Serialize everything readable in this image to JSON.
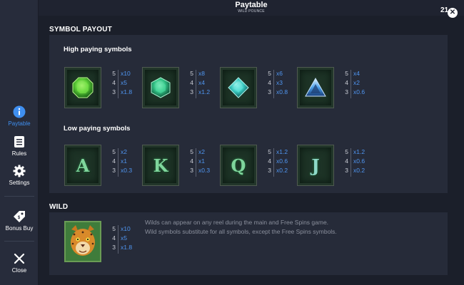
{
  "header": {
    "title": "Paytable",
    "subtitle": "WILD POUNCE",
    "counter": "21"
  },
  "sidebar": {
    "items": [
      {
        "label": "Paytable",
        "icon": "info-icon"
      },
      {
        "label": "Rules",
        "icon": "document-icon"
      },
      {
        "label": "Settings",
        "icon": "gear-icon"
      },
      {
        "label": "Bonus Buy",
        "icon": "price-tag-icon"
      },
      {
        "label": "Close",
        "icon": "close-icon"
      }
    ]
  },
  "colors": {
    "accent": "#3f8ff0",
    "payout_value": "#4f95f0"
  },
  "symbol_payout": {
    "title": "SYMBOL PAYOUT",
    "high_title": "High paying symbols",
    "high": [
      {
        "symbol": "green-octagon-gem-icon",
        "payouts": [
          {
            "count": "5",
            "value": "x10"
          },
          {
            "count": "4",
            "value": "x5"
          },
          {
            "count": "3",
            "value": "x1.8"
          }
        ]
      },
      {
        "symbol": "teal-hexagon-gem-icon",
        "payouts": [
          {
            "count": "5",
            "value": "x8"
          },
          {
            "count": "4",
            "value": "x4"
          },
          {
            "count": "3",
            "value": "x1.2"
          }
        ]
      },
      {
        "symbol": "cyan-diamond-gem-icon",
        "payouts": [
          {
            "count": "5",
            "value": "x6"
          },
          {
            "count": "4",
            "value": "x3"
          },
          {
            "count": "3",
            "value": "x0.8"
          }
        ]
      },
      {
        "symbol": "blue-triangle-gem-icon",
        "payouts": [
          {
            "count": "5",
            "value": "x4"
          },
          {
            "count": "4",
            "value": "x2"
          },
          {
            "count": "3",
            "value": "x0.6"
          }
        ]
      }
    ],
    "low_title": "Low paying symbols",
    "low": [
      {
        "letter": "A",
        "payouts": [
          {
            "count": "5",
            "value": "x2"
          },
          {
            "count": "4",
            "value": "x1"
          },
          {
            "count": "3",
            "value": "x0.3"
          }
        ]
      },
      {
        "letter": "K",
        "payouts": [
          {
            "count": "5",
            "value": "x2"
          },
          {
            "count": "4",
            "value": "x1"
          },
          {
            "count": "3",
            "value": "x0.3"
          }
        ]
      },
      {
        "letter": "Q",
        "payouts": [
          {
            "count": "5",
            "value": "x1.2"
          },
          {
            "count": "4",
            "value": "x0.6"
          },
          {
            "count": "3",
            "value": "x0.2"
          }
        ]
      },
      {
        "letter": "J",
        "payouts": [
          {
            "count": "5",
            "value": "x1.2"
          },
          {
            "count": "4",
            "value": "x0.6"
          },
          {
            "count": "3",
            "value": "x0.2"
          }
        ]
      }
    ]
  },
  "wild": {
    "title": "WILD",
    "symbol": "jaguar-wild-icon",
    "payouts": [
      {
        "count": "5",
        "value": "x10"
      },
      {
        "count": "4",
        "value": "x5"
      },
      {
        "count": "3",
        "value": "x1.8"
      }
    ],
    "text_1": "Wilds can appear on any reel during the main and Free Spins game.",
    "text_2": "Wild symbols substitute for all symbols, except the Free Spins symbols."
  }
}
